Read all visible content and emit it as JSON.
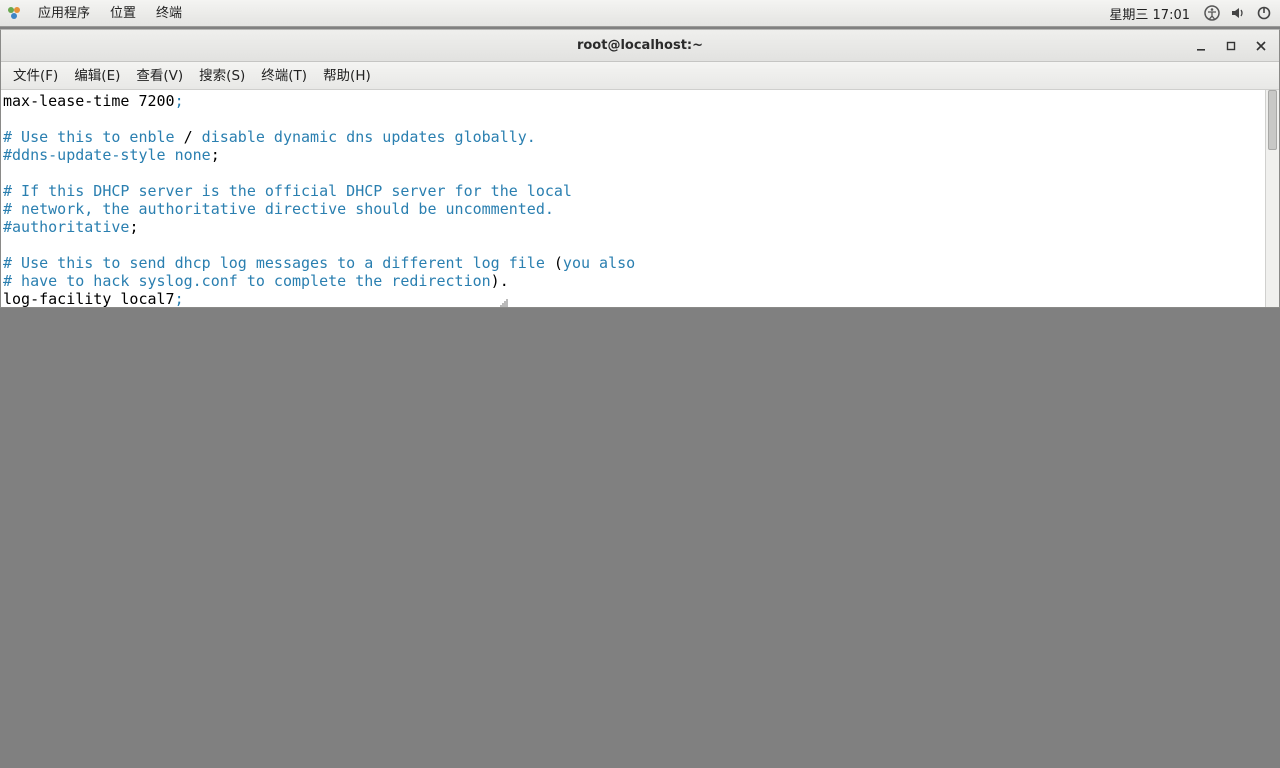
{
  "panel": {
    "menus": [
      "应用程序",
      "位置",
      "终端"
    ],
    "clock": "星期三 17:01"
  },
  "window": {
    "title": "root@localhost:~"
  },
  "menubar": {
    "items": [
      "文件(F)",
      "编辑(E)",
      "查看(V)",
      "搜索(S)",
      "终端(T)",
      "帮助(H)"
    ]
  },
  "terminal": {
    "lines": [
      {
        "segments": [
          {
            "text": "max-lease-time 7200",
            "color": "black"
          },
          {
            "text": ";",
            "color": "blue"
          }
        ]
      },
      {
        "segments": [
          {
            "text": "",
            "color": "black"
          }
        ]
      },
      {
        "segments": [
          {
            "text": "# Use this to enble ",
            "color": "blue"
          },
          {
            "text": "/",
            "color": "black"
          },
          {
            "text": " disable dynamic dns updates globally.",
            "color": "blue"
          }
        ]
      },
      {
        "segments": [
          {
            "text": "#ddns-update-style none",
            "color": "blue"
          },
          {
            "text": ";",
            "color": "black"
          }
        ]
      },
      {
        "segments": [
          {
            "text": "",
            "color": "black"
          }
        ]
      },
      {
        "segments": [
          {
            "text": "# If this DHCP server is the official DHCP server for the local",
            "color": "blue"
          }
        ]
      },
      {
        "segments": [
          {
            "text": "# network, the authoritative directive should be uncommented.",
            "color": "blue"
          }
        ]
      },
      {
        "segments": [
          {
            "text": "#authoritative",
            "color": "blue"
          },
          {
            "text": ";",
            "color": "black"
          }
        ]
      },
      {
        "segments": [
          {
            "text": "",
            "color": "black"
          }
        ]
      },
      {
        "segments": [
          {
            "text": "# Use this to send dhcp log messages to a different log file ",
            "color": "blue"
          },
          {
            "text": "(",
            "color": "black"
          },
          {
            "text": "you also",
            "color": "blue"
          }
        ]
      },
      {
        "segments": [
          {
            "text": "# have to hack syslog.conf to complete the redirection",
            "color": "blue"
          },
          {
            "text": ").",
            "color": "black"
          }
        ]
      },
      {
        "segments": [
          {
            "text": "log-facility local7",
            "color": "black"
          },
          {
            "text": ";",
            "color": "blue"
          }
        ]
      }
    ]
  }
}
